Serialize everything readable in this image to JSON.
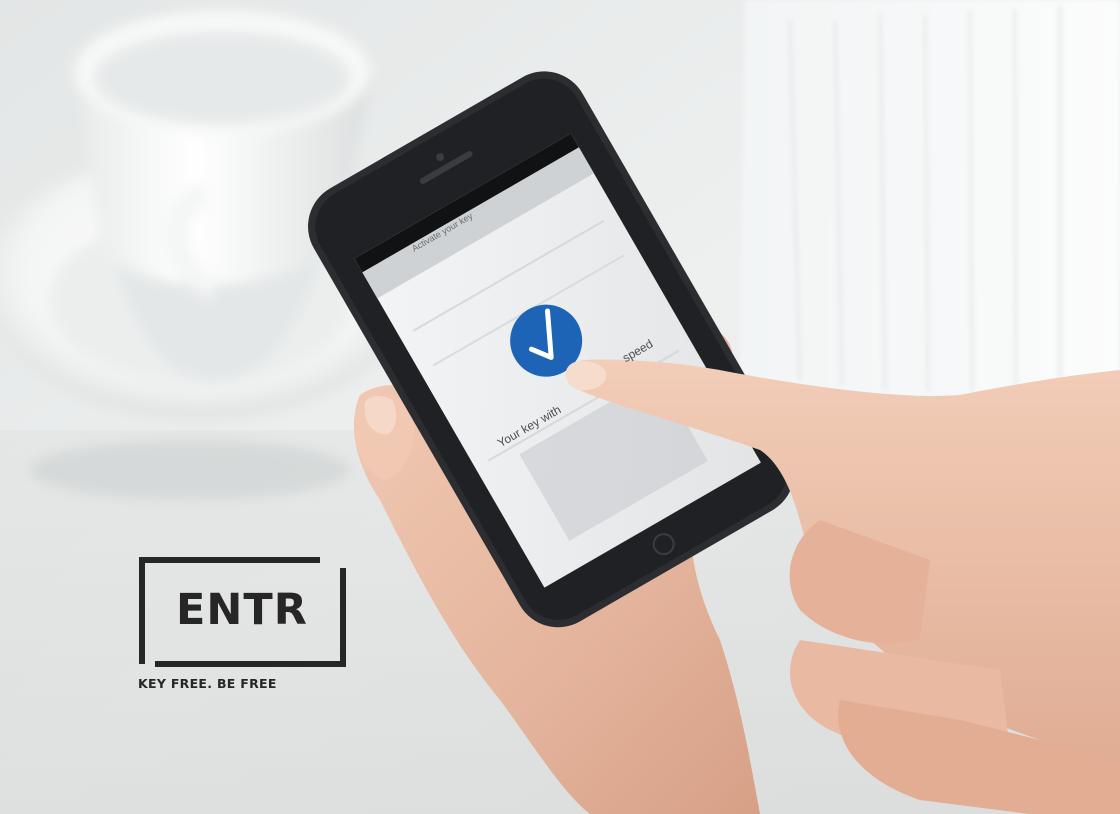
{
  "logo": {
    "wordmark": "ENTR",
    "tagline": "KEY FREE. BE FREE"
  },
  "phone_screen": {
    "title": "Activate your key",
    "message_fragment_1": "Your key with",
    "message_fragment_2": "speed",
    "accent_color": "#1d64b6",
    "check_icon": "checkmark-icon"
  },
  "colors": {
    "logo_ink": "#262626",
    "phone_body": "#2b2d30"
  }
}
